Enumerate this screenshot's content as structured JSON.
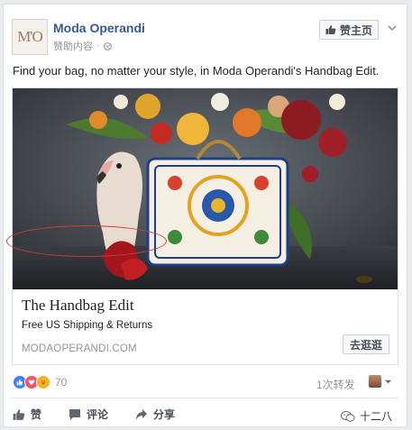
{
  "post": {
    "page_name": "Moda Operandi",
    "avatar_text": "M'O",
    "sponsored_label": "赞助内容",
    "like_page_label": "赞主页",
    "text": "Find your bag, no matter your style, in Moda Operandi's Handbag Edit."
  },
  "ad": {
    "headline": "The Handbag Edit",
    "description": "Free US Shipping & Returns",
    "domain": "MODAOPERANDI.COM",
    "cta_label": "去逛逛"
  },
  "engagement": {
    "reaction_count": "70",
    "shares": "1次转发"
  },
  "actions": {
    "like": "赞",
    "comment": "评论",
    "share": "分享"
  },
  "watermark": "十二八",
  "colors": {
    "brand_blue": "#365899",
    "annotation_red": "#d23a3a",
    "like_blue": "#4080ff",
    "love_red": "#f25268",
    "haha_yellow": "#f7b125"
  }
}
